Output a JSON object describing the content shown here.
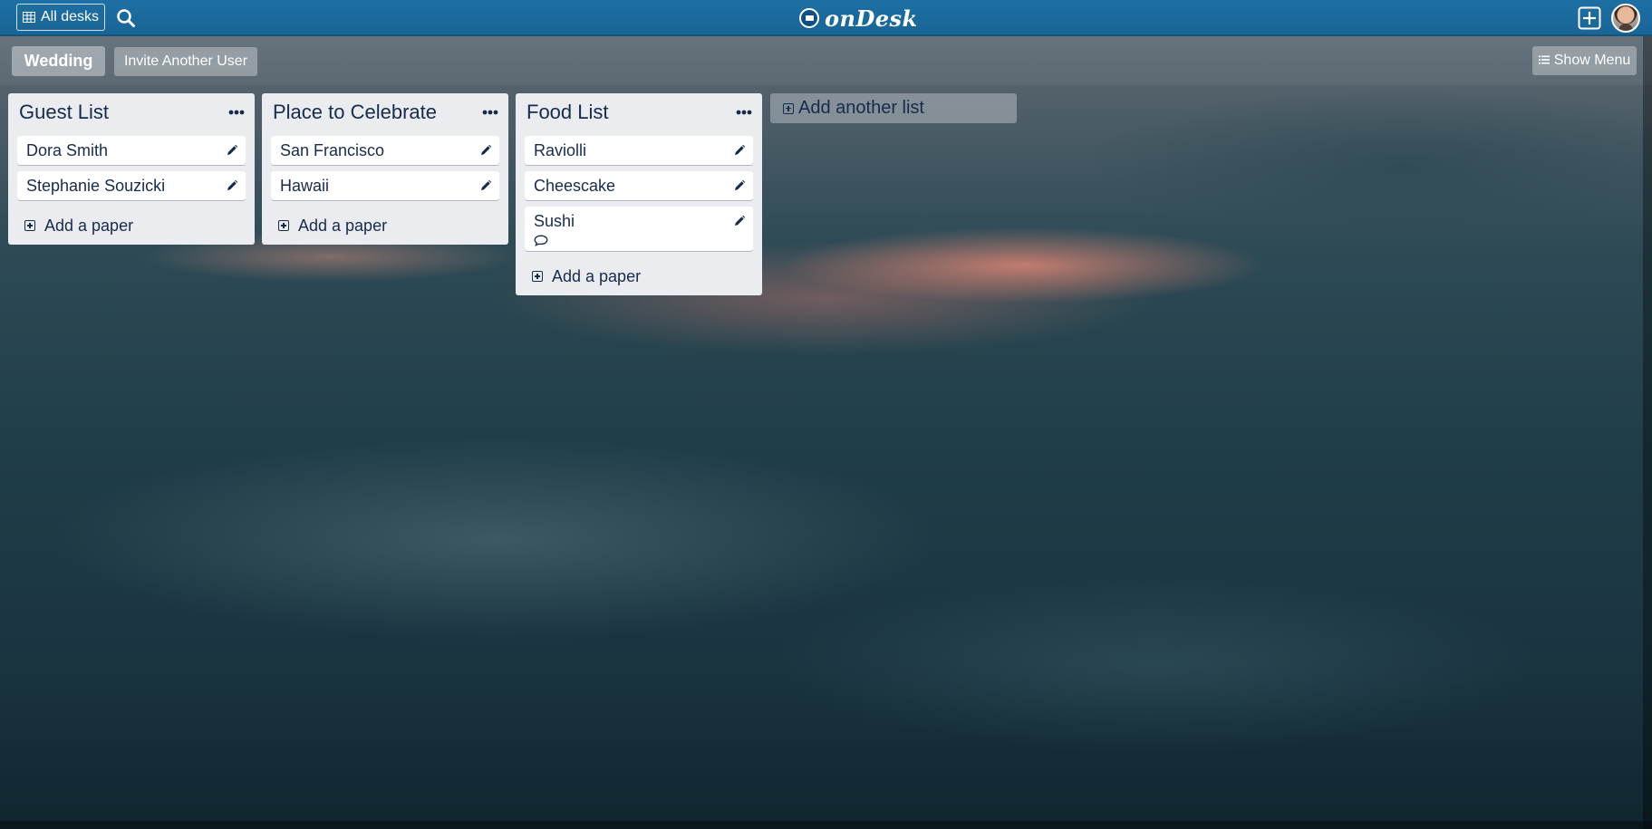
{
  "topbar": {
    "all_desks_label": "All desks",
    "brand_name": "onDesk"
  },
  "board": {
    "name": "Wedding",
    "invite_label": "Invite Another User",
    "show_menu_label": "Show Menu"
  },
  "lists": [
    {
      "title": "Guest List",
      "cards": [
        {
          "title": "Dora Smith"
        },
        {
          "title": "Stephanie Souzicki"
        }
      ],
      "add_label": "Add a paper"
    },
    {
      "title": "Place to Celebrate",
      "cards": [
        {
          "title": "San Francisco"
        },
        {
          "title": "Hawaii"
        }
      ],
      "add_label": "Add a paper"
    },
    {
      "title": "Food List",
      "cards": [
        {
          "title": "Raviolli"
        },
        {
          "title": "Cheescake"
        },
        {
          "title": "Sushi",
          "has_comment": true
        }
      ],
      "add_label": "Add a paper"
    }
  ],
  "add_list_label": "Add another list",
  "icons": {
    "grid": "grid-icon",
    "search": "search-icon",
    "logo": "ondesk-logo-icon",
    "add": "plus-square-icon",
    "menu": "more-horizontal-icon",
    "edit": "pencil-icon",
    "comment": "comment-icon",
    "list": "list-icon"
  },
  "colors": {
    "topbar": "#1d6fa3",
    "list_bg": "#ebecf0",
    "text": "#172b4d"
  }
}
